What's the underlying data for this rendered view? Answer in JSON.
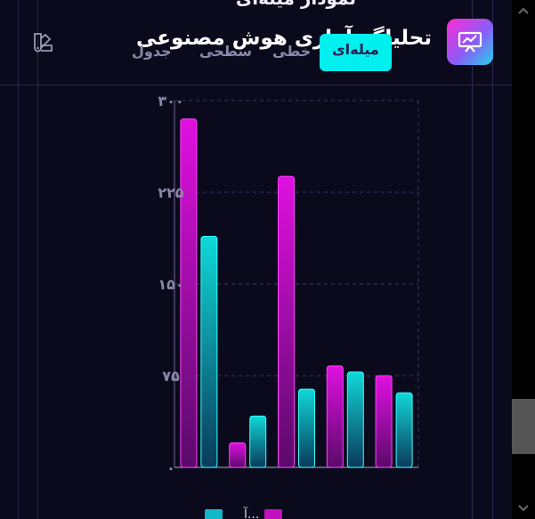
{
  "header": {
    "title": "تحلیلگر آماری هوش مصنوعی",
    "clipped_subtitle": "نمودار میله‌ای"
  },
  "tabs": [
    {
      "label": "میله‌ای",
      "active": true
    },
    {
      "label": "خطی",
      "active": false
    },
    {
      "label": "سطحی",
      "active": false
    },
    {
      "label": "جدول",
      "active": false
    }
  ],
  "icons": {
    "logo": "presentation-chart-icon",
    "theme": "palette-icon",
    "scroll_up": "chevron-up-icon",
    "scroll_down": "chevron-down-icon"
  },
  "colors": {
    "accent": "#00f0f0",
    "series_a": "#e010e0",
    "series_b": "#10d8d8",
    "background": "#0b0a1c"
  },
  "chart_data": {
    "type": "bar",
    "categories": [
      "",
      "",
      "",
      "",
      ""
    ],
    "series": [
      {
        "name": "",
        "values": [
          285,
          20,
          238,
          83,
          75
        ]
      },
      {
        "name": "",
        "values": [
          189,
          42,
          64,
          78,
          61
        ]
      }
    ],
    "y_ticks": [
      "۰",
      "۷۵",
      "۱۵۰",
      "۲۲۵",
      "۳۰۰"
    ],
    "ylim": [
      0,
      300
    ],
    "grid": true
  },
  "legend": {
    "items": [
      "",
      "آ..."
    ]
  }
}
